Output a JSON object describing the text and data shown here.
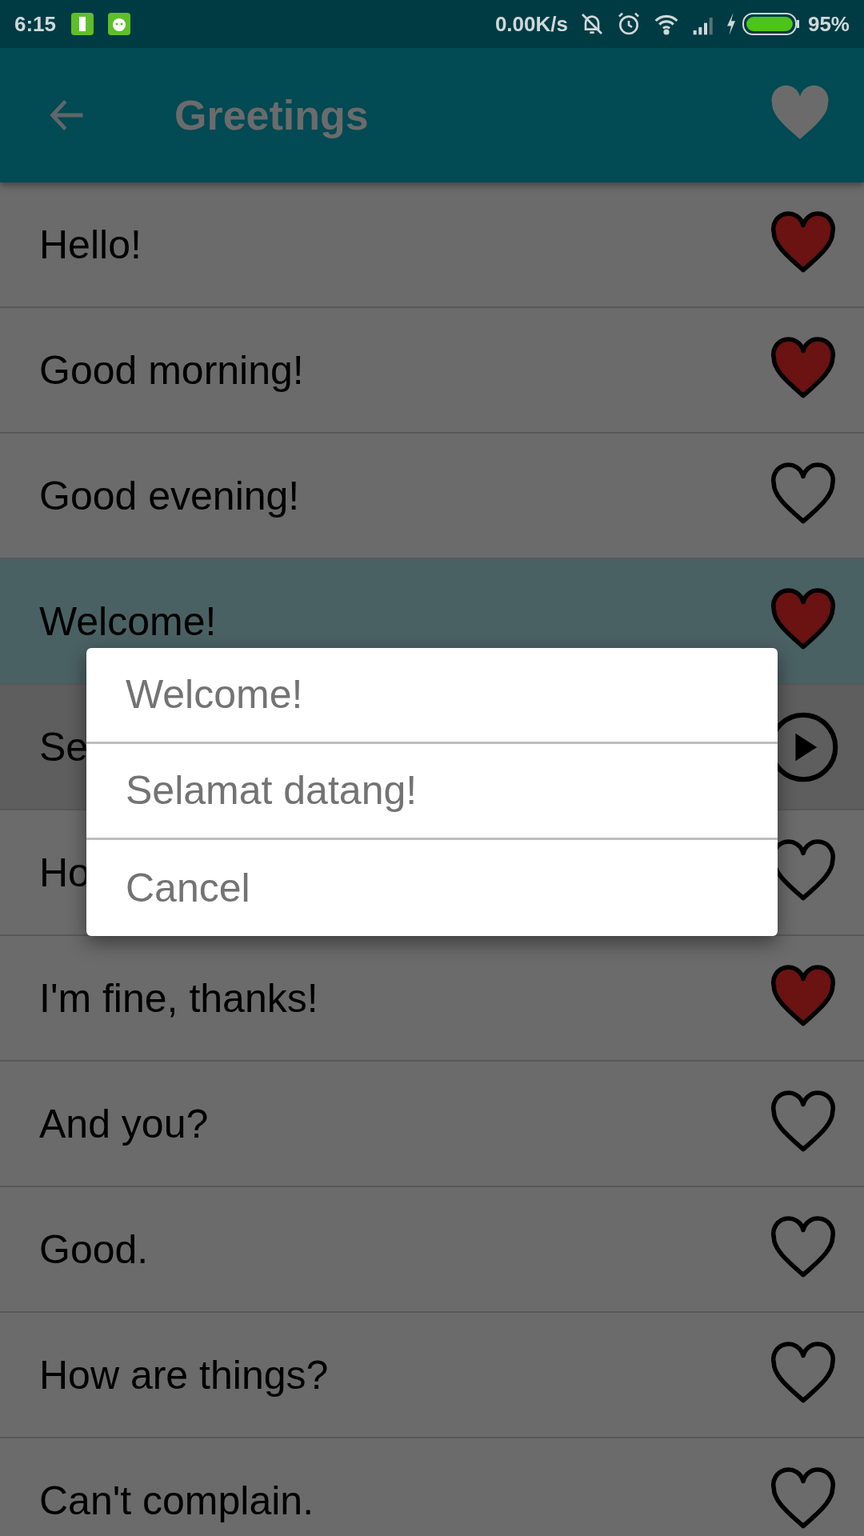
{
  "status_bar": {
    "time": "6:15",
    "speed": "0.00K/s",
    "battery": "95%"
  },
  "app_bar": {
    "title": "Greetings"
  },
  "rows": [
    {
      "text": "Hello!",
      "kind": "favorite",
      "favorite": true,
      "selected": false
    },
    {
      "text": "Good morning!",
      "kind": "favorite",
      "favorite": true,
      "selected": false
    },
    {
      "text": "Good evening!",
      "kind": "favorite",
      "favorite": false,
      "selected": false
    },
    {
      "text": "Welcome!",
      "kind": "favorite",
      "favorite": true,
      "selected": true
    },
    {
      "text": "Se",
      "kind": "play",
      "selected": false
    },
    {
      "text": "Ho",
      "kind": "favorite",
      "favorite": false,
      "selected": false
    },
    {
      "text": "I'm fine, thanks!",
      "kind": "favorite",
      "favorite": true,
      "selected": false
    },
    {
      "text": "And you?",
      "kind": "favorite",
      "favorite": false,
      "selected": false
    },
    {
      "text": "Good.",
      "kind": "favorite",
      "favorite": false,
      "selected": false
    },
    {
      "text": "How are things?",
      "kind": "favorite",
      "favorite": false,
      "selected": false
    },
    {
      "text": "Can't complain.",
      "kind": "favorite",
      "favorite": false,
      "selected": false
    }
  ],
  "dialog": {
    "options": [
      "Welcome!",
      "Selamat datang!",
      "Cancel"
    ]
  }
}
